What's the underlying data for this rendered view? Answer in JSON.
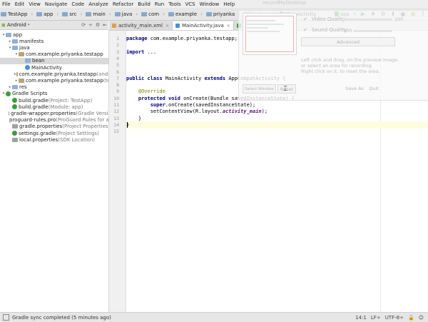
{
  "menu": [
    "File",
    "Edit",
    "View",
    "Navigate",
    "Code",
    "Analyze",
    "Refactor",
    "Build",
    "Run",
    "Tools",
    "VCS",
    "Window",
    "Help"
  ],
  "breadcrumb": [
    "TestApp",
    "app",
    "src",
    "main",
    "java",
    "com",
    "example",
    "priyanka",
    "testapp",
    "MainActivity"
  ],
  "toolbar": {
    "run_config": "app"
  },
  "project_panel": {
    "view_mode": "Android"
  },
  "tree": [
    {
      "label": "app",
      "hint": "",
      "depth": 0,
      "arrow": "▾",
      "icon": "folder"
    },
    {
      "label": "manifests",
      "hint": "",
      "depth": 1,
      "arrow": "▸",
      "icon": "folder"
    },
    {
      "label": "java",
      "hint": "",
      "depth": 1,
      "arrow": "▾",
      "icon": "folder"
    },
    {
      "label": "com.example.priyanka.testapp",
      "hint": "",
      "depth": 2,
      "arrow": "▾",
      "icon": "pkg"
    },
    {
      "label": "bean",
      "hint": "",
      "depth": 3,
      "arrow": "",
      "icon": "folder",
      "selected": true
    },
    {
      "label": "MainActivity",
      "hint": "",
      "depth": 3,
      "arrow": "",
      "icon": "cls"
    },
    {
      "label": "com.example.priyanka.testapp",
      "hint": " (androidTe",
      "depth": 2,
      "arrow": "▸",
      "icon": "pkg"
    },
    {
      "label": "com.example.priyanka.testapp",
      "hint": " (test)",
      "depth": 2,
      "arrow": "▸",
      "icon": "pkg"
    },
    {
      "label": "res",
      "hint": "",
      "depth": 1,
      "arrow": "▸",
      "icon": "folder"
    },
    {
      "label": "Gradle Scripts",
      "hint": "",
      "depth": 0,
      "arrow": "▾",
      "icon": "gradle"
    },
    {
      "label": "build.gradle",
      "hint": " (Project: TestApp)",
      "depth": 1,
      "arrow": "",
      "icon": "gradle"
    },
    {
      "label": "build.gradle",
      "hint": " (Module: app)",
      "depth": 1,
      "arrow": "",
      "icon": "gradle"
    },
    {
      "label": "gradle-wrapper.properties",
      "hint": " (Gradle Version)",
      "depth": 1,
      "arrow": "",
      "icon": "prop"
    },
    {
      "label": "proguard-rules.pro",
      "hint": " (ProGuard Rules for app)",
      "depth": 1,
      "arrow": "",
      "icon": "prop"
    },
    {
      "label": "gradle.properties",
      "hint": " (Project Properties)",
      "depth": 1,
      "arrow": "",
      "icon": "prop"
    },
    {
      "label": "settings.gradle",
      "hint": " (Project Settings)",
      "depth": 1,
      "arrow": "",
      "icon": "gradle"
    },
    {
      "label": "local.properties",
      "hint": " (SDK Location)",
      "depth": 1,
      "arrow": "",
      "icon": "prop"
    }
  ],
  "tabs": [
    {
      "label": "activity_main.xml",
      "active": false,
      "color": "#e39b4a"
    },
    {
      "label": "MainActivity.java",
      "active": true,
      "color": "#4a90d9"
    },
    {
      "label": "app",
      "active": false,
      "color": "#3b9c3b"
    }
  ],
  "code_lines": [
    {
      "num": "1",
      "html": "<span class='kw'>package</span> com.example.priyanka.testapp;"
    },
    {
      "num": "2",
      "html": ""
    },
    {
      "num": "3",
      "html": "<span class='kw'>import</span> ..."
    },
    {
      "num": "4",
      "html": ""
    },
    {
      "num": "5",
      "html": ""
    },
    {
      "num": "6",
      "html": ""
    },
    {
      "num": "7",
      "html": "<span class='kw'>public class</span> MainActivity <span class='kw'>extends</span> AppCompatActivity {"
    },
    {
      "num": "8",
      "html": ""
    },
    {
      "num": "9",
      "html": "    <span class='an'>@Override</span>"
    },
    {
      "num": "10",
      "html": "    <span class='kw'>protected void</span> onCreate(Bundle savedInstanceState) {"
    },
    {
      "num": "11",
      "html": "        <span class='kw'>super</span>.onCreate(savedInstanceState);"
    },
    {
      "num": "12",
      "html": "        setContentView(R.layout.<span class='it'>activity_main</span>);"
    },
    {
      "num": "13",
      "html": "    }"
    },
    {
      "num": "14",
      "html": "}"
    },
    {
      "num": "15",
      "html": ""
    }
  ],
  "recorder": {
    "title": "recordMyDesktop",
    "video_quality_label": "Video Quality",
    "video_quality_value": "100",
    "sound_quality_label": "Sound Quality",
    "sound_quality_value": "100",
    "advanced_label": "Advanced",
    "help_text_1": "Left click and drag, on the preview image,",
    "help_text_2": "or select an area for recording.",
    "help_text_3": "Right click on it, to reset the area.",
    "select_window_label": "Select Window",
    "reset_label": "Reset",
    "save_as_label": "Save As",
    "quit_label": "Quit",
    "video_check": "✔",
    "sound_check": "✔"
  },
  "status": {
    "message": "Gradle sync completed (5 minutes ago)",
    "position": "14:1",
    "line_sep": "LF÷",
    "encoding": "UTF-8÷"
  }
}
